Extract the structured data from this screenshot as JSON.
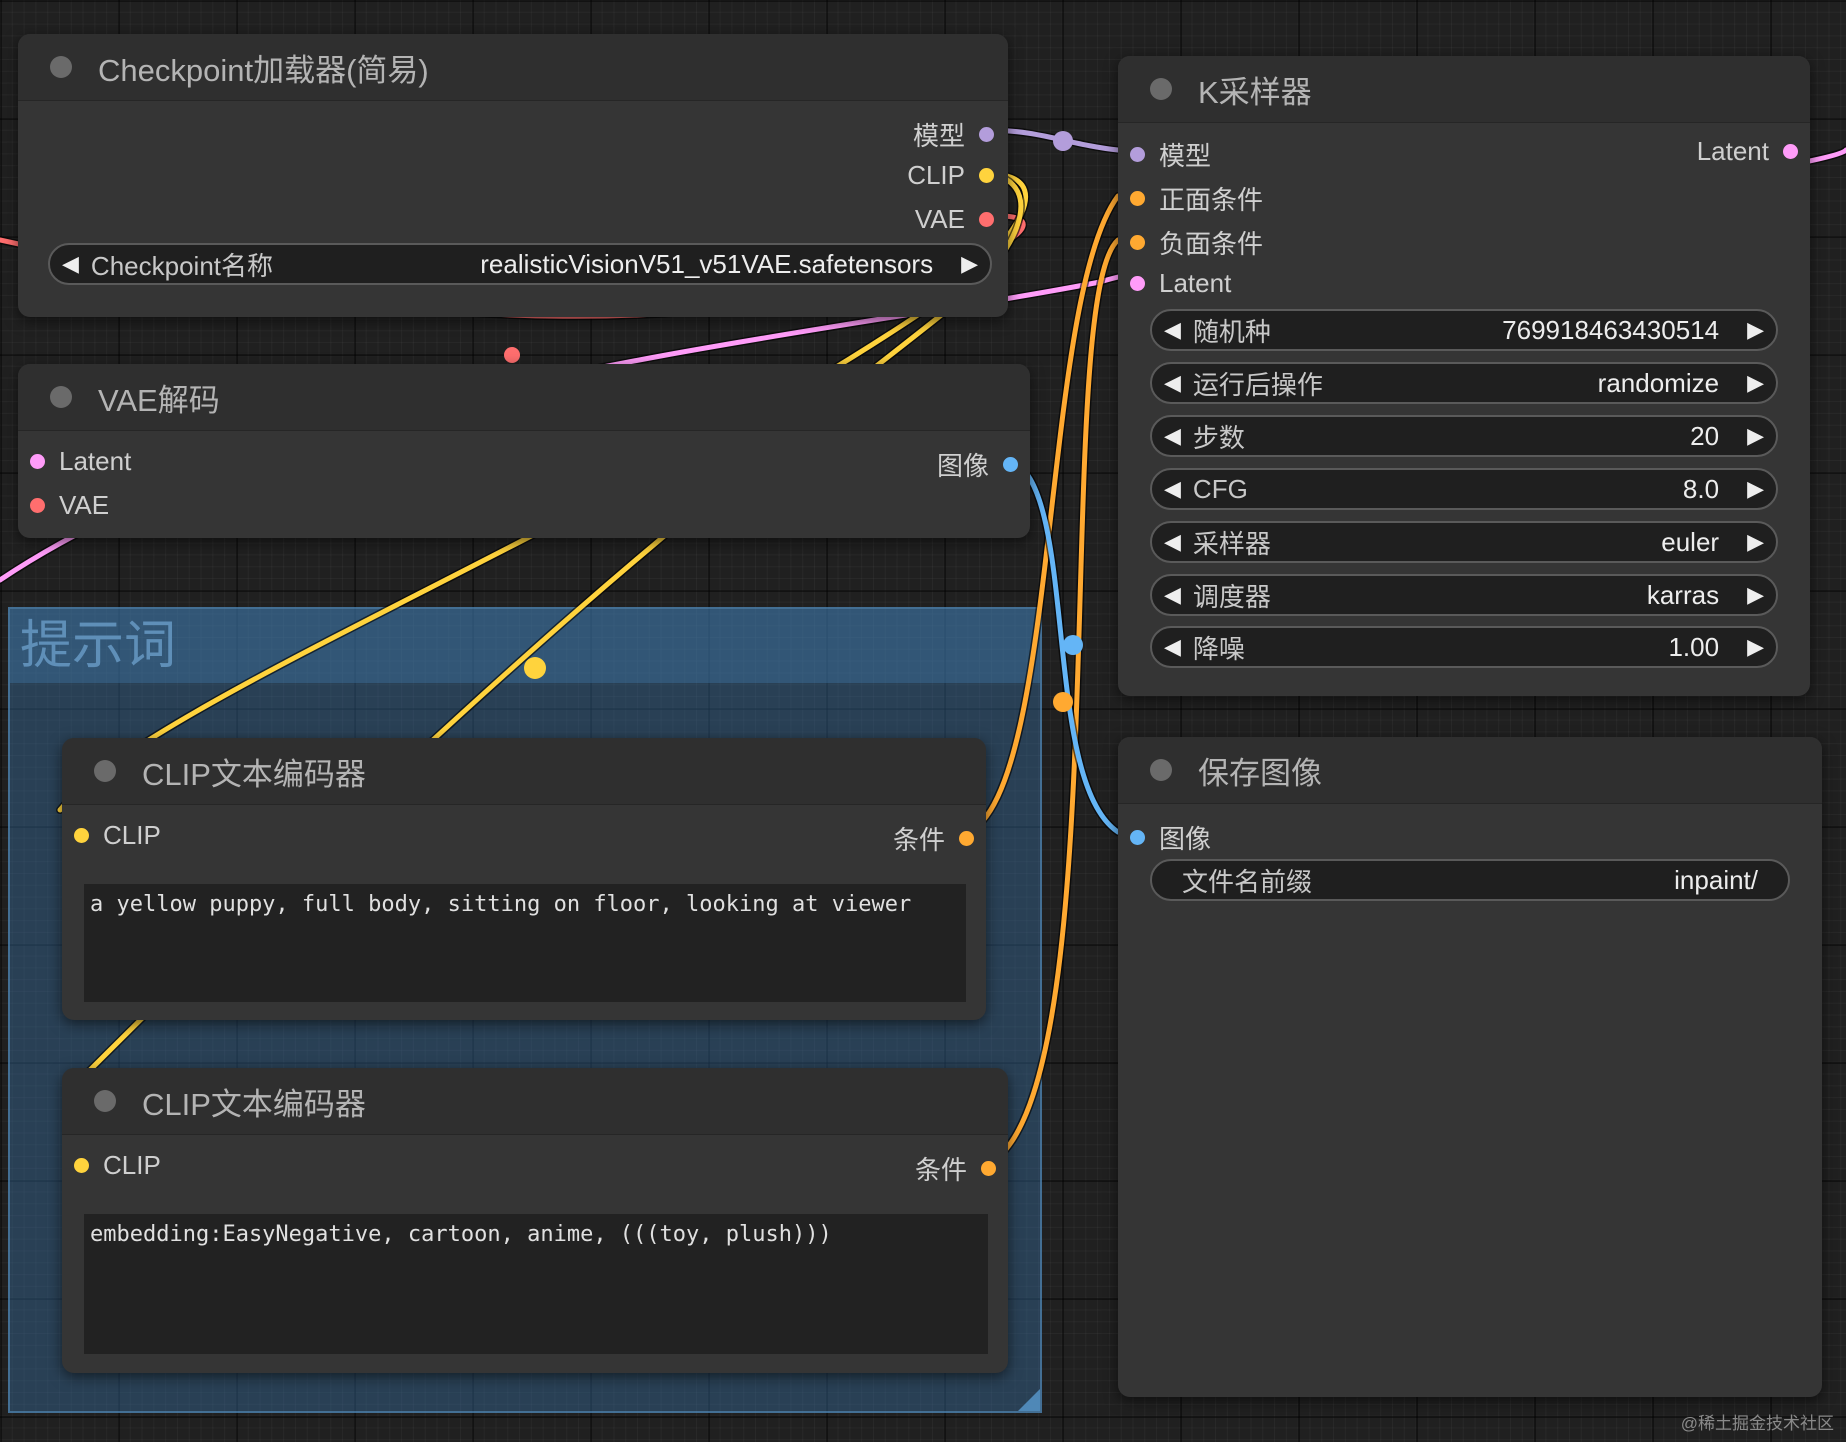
{
  "group": {
    "title": "提示词"
  },
  "nodes": {
    "checkpoint": {
      "title": "Checkpoint加载器(简易)",
      "outputs": [
        "模型",
        "CLIP",
        "VAE"
      ],
      "widget": {
        "label": "Checkpoint名称",
        "value": "realisticVisionV51_v51VAE.safetensors"
      }
    },
    "vae_decode": {
      "title": "VAE解码",
      "inputs": [
        "Latent",
        "VAE"
      ],
      "outputs": [
        "图像"
      ]
    },
    "clip_positive": {
      "title": "CLIP文本编码器",
      "inputs": [
        "CLIP"
      ],
      "outputs": [
        "条件"
      ],
      "text": "a yellow puppy, full body, sitting on floor, looking at viewer"
    },
    "clip_negative": {
      "title": "CLIP文本编码器",
      "inputs": [
        "CLIP"
      ],
      "outputs": [
        "条件"
      ],
      "text": "embedding:EasyNegative, cartoon, anime, (((toy, plush)))"
    },
    "ksampler": {
      "title": "K采样器",
      "inputs": [
        "模型",
        "正面条件",
        "负面条件",
        "Latent"
      ],
      "outputs": [
        "Latent"
      ],
      "widgets": [
        {
          "label": "随机种",
          "value": "769918463430514"
        },
        {
          "label": "运行后操作",
          "value": "randomize"
        },
        {
          "label": "步数",
          "value": "20"
        },
        {
          "label": "CFG",
          "value": "8.0"
        },
        {
          "label": "采样器",
          "value": "euler"
        },
        {
          "label": "调度器",
          "value": "karras"
        },
        {
          "label": "降噪",
          "value": "1.00"
        }
      ]
    },
    "save_image": {
      "title": "保存图像",
      "inputs": [
        "图像"
      ],
      "widget": {
        "label": "文件名前缀",
        "value": "inpaint/"
      }
    }
  },
  "colors": {
    "model": "#b39ddb",
    "clip": "#ffd33d",
    "vae": "#ff6e6e",
    "latent": "#ff9cf9",
    "conditioning": "#ffa931",
    "image": "#64b5f6"
  },
  "watermark": "@稀土掘金技术社区"
}
